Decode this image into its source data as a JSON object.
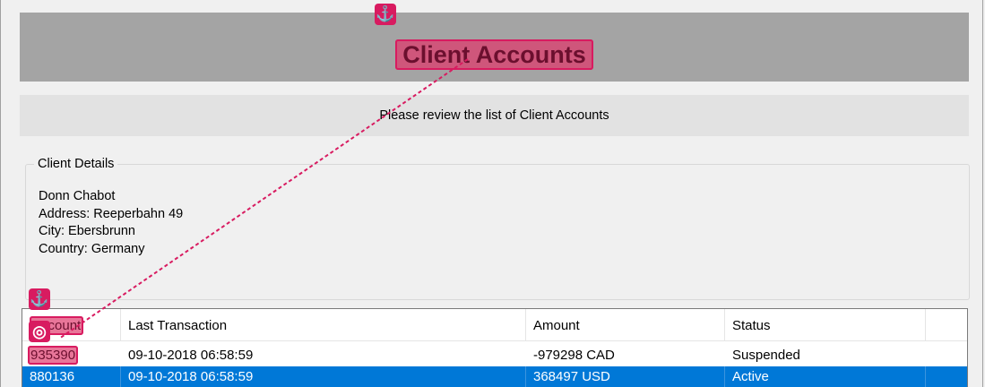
{
  "header": {
    "title": "Client Accounts"
  },
  "banner": {
    "text": "Please review the list of Client Accounts"
  },
  "client_details": {
    "legend": "Client Details",
    "name": "Donn Chabot",
    "address": "Address: Reeperbahn 49",
    "city": "City: Ebersbrunn",
    "country": "Country: Germany"
  },
  "grid": {
    "columns": [
      "Account",
      "Last Transaction",
      "Amount",
      "Status"
    ],
    "rows": [
      {
        "account": "935390",
        "last_transaction": "09-10-2018 06:58:59",
        "amount": "-979298 CAD",
        "status": "Suspended",
        "selected": false
      },
      {
        "account": "880136",
        "last_transaction": "09-10-2018 06:58:59",
        "amount": "368497 USD",
        "status": "Active",
        "selected": true
      }
    ]
  },
  "overlay": {
    "anchor_icon": "anchor-icon",
    "target_icon": "target-icon",
    "anchor_glyph": "⚓",
    "target_glyph": "◎",
    "highlight_color": "#d81b60",
    "selection_color": "#0078d7"
  }
}
